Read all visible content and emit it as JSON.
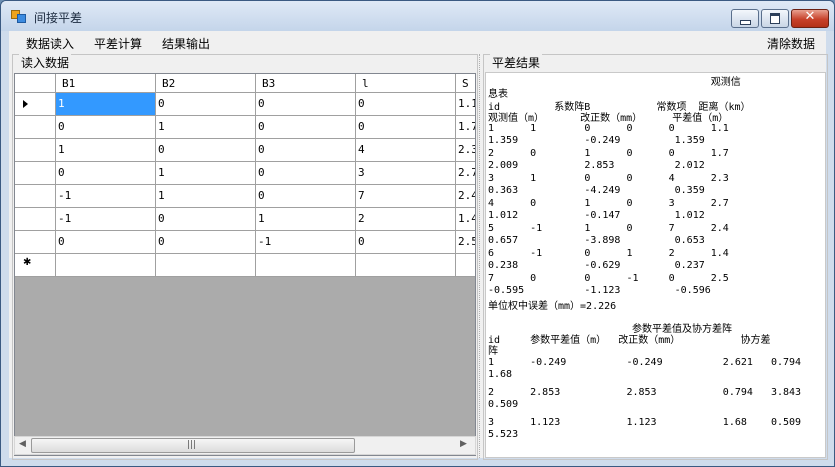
{
  "window": {
    "title": "间接平差"
  },
  "menu": {
    "items": [
      "数据读入",
      "平差计算",
      "结果输出"
    ],
    "clear_button": "清除数据"
  },
  "input_panel": {
    "label": "读入数据",
    "columns": [
      "B1",
      "B2",
      "B3",
      "l",
      "S"
    ],
    "rows": [
      [
        "1",
        "0",
        "0",
        "0",
        "1.1"
      ],
      [
        "0",
        "1",
        "0",
        "0",
        "1.7"
      ],
      [
        "1",
        "0",
        "0",
        "4",
        "2.3"
      ],
      [
        "0",
        "1",
        "0",
        "3",
        "2.7"
      ],
      [
        "-1",
        "1",
        "0",
        "7",
        "2.4"
      ],
      [
        "-1",
        "0",
        "1",
        "2",
        "1.4"
      ],
      [
        "0",
        "0",
        "-1",
        "0",
        "2.5"
      ]
    ],
    "selected_cell": "row 1, B1"
  },
  "result_panel": {
    "label": "平差结果",
    "text_lines": [
      "                                     观测信",
      "息表",
      "id         系数阵B           常数项  距离（km）",
      "观测值（m）      改正数（mm）     平差值（m）",
      "1      1        0      0      0      1.1",
      "1.359           -0.249         1.359",
      "2      0        1      0      0      1.7",
      "2.009           2.853          2.012",
      "3      1        0      0      4      2.3",
      "0.363           -4.249         0.359",
      "4      0        1      0      3      2.7",
      "1.012           -0.147         1.012",
      "5      -1       1      0      7      2.4",
      "0.657           -3.898         0.653",
      "6      -1       0      1      2      1.4",
      "0.238           -0.629         0.237",
      "7      0        0      -1     0      2.5",
      "-0.595          -1.123         -0.596",
      "单位权中误差（mm）=2.226"
    ],
    "second_table": {
      "title": "参数平差值及协方差阵",
      "header_line_1": "id     参数平差值（m）  改正数（mm）          协方差",
      "header_line_2": "阵",
      "rows": [
        "1      -0.249          -0.249          2.621   0.794",
        "1.68",
        "2      2.853           2.853           0.794   3.843",
        "0.509",
        "3      1.123           1.123           1.68    0.509",
        "5.523"
      ]
    }
  }
}
